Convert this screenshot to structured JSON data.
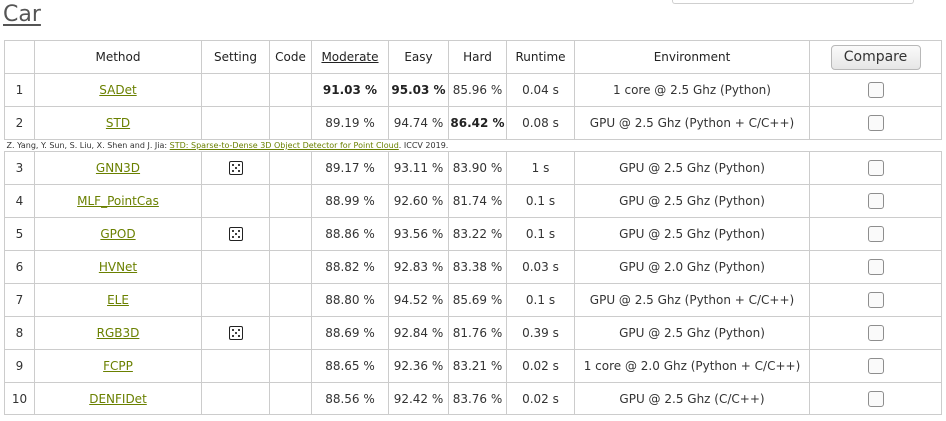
{
  "page_title": "Car",
  "table": {
    "headers": {
      "method": "Method",
      "setting": "Setting",
      "code": "Code",
      "moderate": "Moderate",
      "easy": "Easy",
      "hard": "Hard",
      "runtime": "Runtime",
      "environment": "Environment",
      "compare": "Compare"
    },
    "rows": [
      {
        "rank": "1",
        "method": "SADet",
        "setting_icon": "",
        "moderate": "91.03 %",
        "easy": "95.03 %",
        "hard": "85.96 %",
        "runtime": "0.04 s",
        "environment": "1 core @ 2.5 Ghz (Python)"
      },
      {
        "rank": "2",
        "method": "STD",
        "setting_icon": "",
        "moderate": "89.19 %",
        "easy": "94.74 %",
        "hard": "86.42 %",
        "runtime": "0.08 s",
        "environment": "GPU @ 2.5 Ghz (Python + C/C++)"
      },
      {
        "rank": "3",
        "method": "GNN3D",
        "setting_icon": "dice-icon",
        "moderate": "89.17 %",
        "easy": "93.11 %",
        "hard": "83.90 %",
        "runtime": "1 s",
        "environment": "GPU @ 2.5 Ghz (Python)"
      },
      {
        "rank": "4",
        "method": "MLF_PointCas",
        "setting_icon": "",
        "moderate": "88.99 %",
        "easy": "92.60 %",
        "hard": "81.74 %",
        "runtime": "0.1 s",
        "environment": "GPU @ 2.5 Ghz (Python)"
      },
      {
        "rank": "5",
        "method": "GPOD",
        "setting_icon": "dice-icon",
        "moderate": "88.86 %",
        "easy": "93.56 %",
        "hard": "83.22 %",
        "runtime": "0.1 s",
        "environment": "GPU @ 2.5 Ghz (Python)"
      },
      {
        "rank": "6",
        "method": "HVNet",
        "setting_icon": "",
        "moderate": "88.82 %",
        "easy": "92.83 %",
        "hard": "83.38 %",
        "runtime": "0.03 s",
        "environment": "GPU @ 2.0 Ghz (Python)"
      },
      {
        "rank": "7",
        "method": "ELE",
        "setting_icon": "",
        "moderate": "88.80 %",
        "easy": "94.52 %",
        "hard": "85.69 %",
        "runtime": "0.1 s",
        "environment": "GPU @ 2.5 Ghz (Python + C/C++)"
      },
      {
        "rank": "8",
        "method": "RGB3D",
        "setting_icon": "dice-icon",
        "moderate": "88.69 %",
        "easy": "92.84 %",
        "hard": "81.76 %",
        "runtime": "0.39 s",
        "environment": "GPU @ 2.5 Ghz (Python)"
      },
      {
        "rank": "9",
        "method": "FCPP",
        "setting_icon": "",
        "moderate": "88.65 %",
        "easy": "92.36 %",
        "hard": "83.21 %",
        "runtime": "0.02 s",
        "environment": "1 core @ 2.0 Ghz (Python + C/C++)"
      },
      {
        "rank": "10",
        "method": "DENFIDet",
        "setting_icon": "",
        "moderate": "88.56 %",
        "easy": "92.42 %",
        "hard": "83.76 %",
        "runtime": "0.02 s",
        "environment": "GPU @ 2.5 Ghz (C/C++)"
      }
    ],
    "citation": {
      "authors": "Z. Yang, Y. Sun, S. Liu, X. Shen and J. Jia: ",
      "paper_title": "STD: Sparse-to-Dense 3D Object Detector for Point Cloud",
      "venue": ". ICCV 2019."
    }
  },
  "colors": {
    "link": "#6a8000",
    "sorted_header": "#d40000",
    "border": "#cccccc"
  }
}
